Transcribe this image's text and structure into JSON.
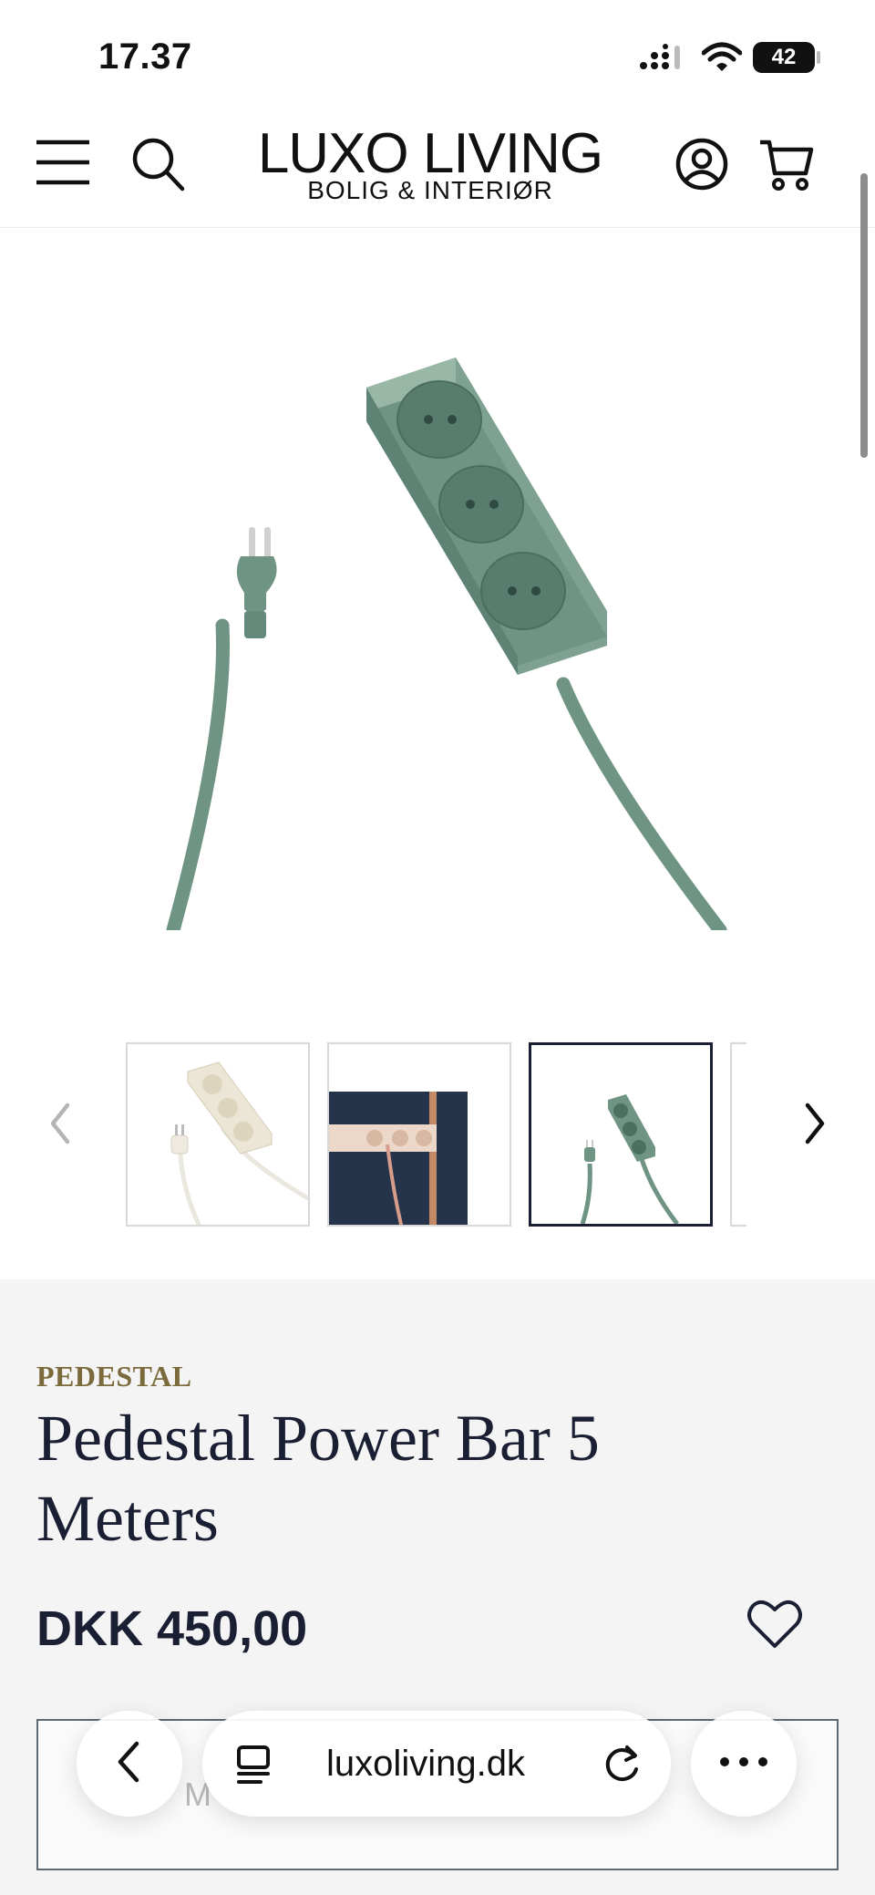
{
  "status_bar": {
    "time": "17.37",
    "battery": "42",
    "icons": [
      "signal-icon",
      "wifi-icon",
      "battery-icon"
    ]
  },
  "header": {
    "logo_main": "LUXO LIVING",
    "logo_sub": "BOLIG & INTERIØR",
    "icons": [
      "menu-icon",
      "search-icon",
      "account-icon",
      "cart-icon"
    ]
  },
  "gallery": {
    "main_image": "green-power-bar-image",
    "thumbnails": [
      "white-power-bar-thumbnail",
      "wall-mounted-power-bar-thumbnail",
      "green-power-bar-thumbnail",
      "partial-thumbnail"
    ],
    "active_index": 2,
    "icons": [
      "chevron-left-icon",
      "chevron-right-icon"
    ]
  },
  "product": {
    "brand": "PEDESTAL",
    "title": "Pedestal Power Bar 5 Meters",
    "price": "DKK 450,00",
    "option_partial": "M"
  },
  "browser": {
    "url": "luxoliving.dk",
    "icons": [
      "back-icon",
      "reader-icon",
      "reload-icon",
      "more-icon"
    ]
  },
  "colors": {
    "navy": "#1b1f33",
    "brand_gold": "#7b6a3c",
    "product_green": "#6f9484",
    "panel_gray": "#f4f4f4"
  }
}
